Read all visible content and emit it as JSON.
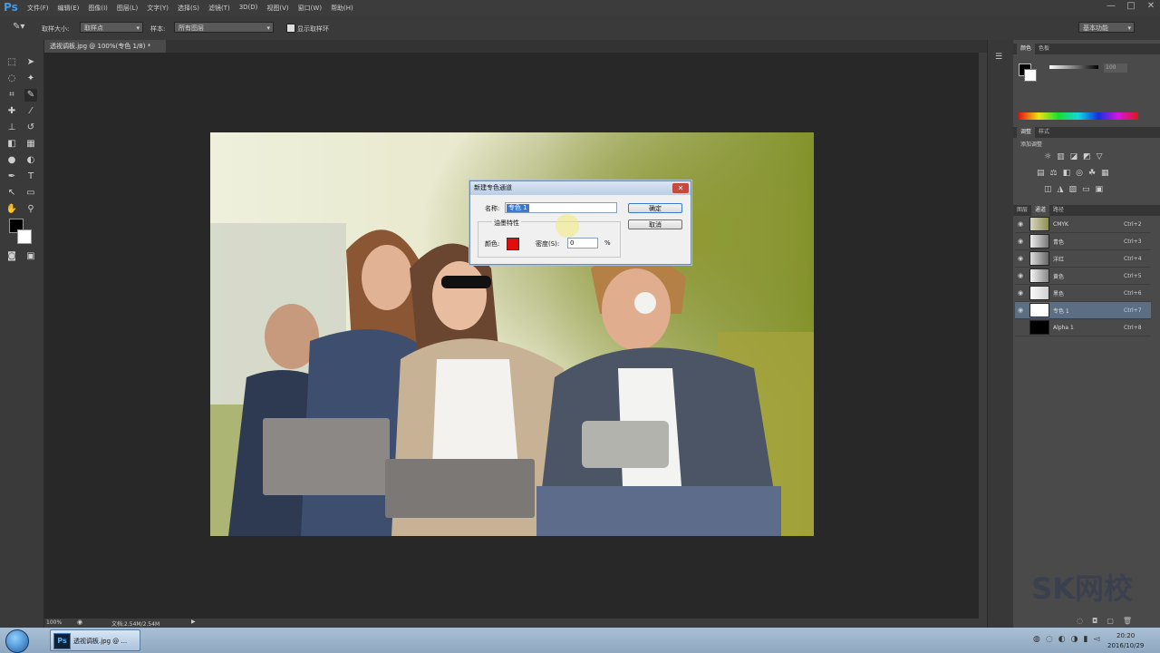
{
  "menubar": {
    "logo": "Ps",
    "items": [
      "文件(F)",
      "编辑(E)",
      "图像(I)",
      "图层(L)",
      "文字(Y)",
      "选择(S)",
      "滤镜(T)",
      "3D(D)",
      "视图(V)",
      "窗口(W)",
      "帮助(H)"
    ],
    "minimize": "—",
    "maximize": "□",
    "close": "✕"
  },
  "options": {
    "sample_size_label": "取样大小:",
    "sample_size_value": "取样点",
    "sample_label": "样本:",
    "sample_value": "所有图层",
    "show_ring_label": "显示取样环",
    "workspace": "基本功能"
  },
  "document": {
    "tab_title": "透视调板.jpg @ 100%(专色 1/8) *",
    "zoom": "100%",
    "doc_info": "文档:2.54M/2.54M"
  },
  "dialog": {
    "title": "新建专色通道",
    "name_label": "名称:",
    "name_value": "专色 1",
    "ink_section": "油墨特性",
    "color_label": "颜色:",
    "color": "#e10d0d",
    "solidity_label": "密度(S):",
    "solidity_value": "0",
    "percent": "%",
    "ok": "确定",
    "cancel": "取消"
  },
  "right_panel": {
    "color_tabs": [
      "颜色",
      "色板"
    ],
    "opacity_value": "100",
    "adjust_tabs": [
      "调整",
      "样式"
    ],
    "adjust_title": "添加调整",
    "channel_tabs": [
      "图层",
      "通道",
      "路径"
    ],
    "channels": [
      {
        "name": "CMYK",
        "shortcut": "Ctrl+2",
        "visible": true
      },
      {
        "name": "青色",
        "shortcut": "Ctrl+3",
        "visible": true
      },
      {
        "name": "洋红",
        "shortcut": "Ctrl+4",
        "visible": true
      },
      {
        "name": "黄色",
        "shortcut": "Ctrl+5",
        "visible": true
      },
      {
        "name": "黑色",
        "shortcut": "Ctrl+6",
        "visible": true
      },
      {
        "name": "专色 1",
        "shortcut": "Ctrl+7",
        "visible": true
      },
      {
        "name": "Alpha 1",
        "shortcut": "Ctrl+8",
        "visible": false
      }
    ]
  },
  "taskbar": {
    "task_label": "透视调板.jpg @ ...",
    "ps_icon": "Ps",
    "time": "20:20",
    "date": "2016/10/29"
  },
  "watermark": "SK网校",
  "accent_colors": {
    "selection": "#3b79d1",
    "active_channel": "#5c6e84",
    "spot_color": "#e10d0d"
  }
}
